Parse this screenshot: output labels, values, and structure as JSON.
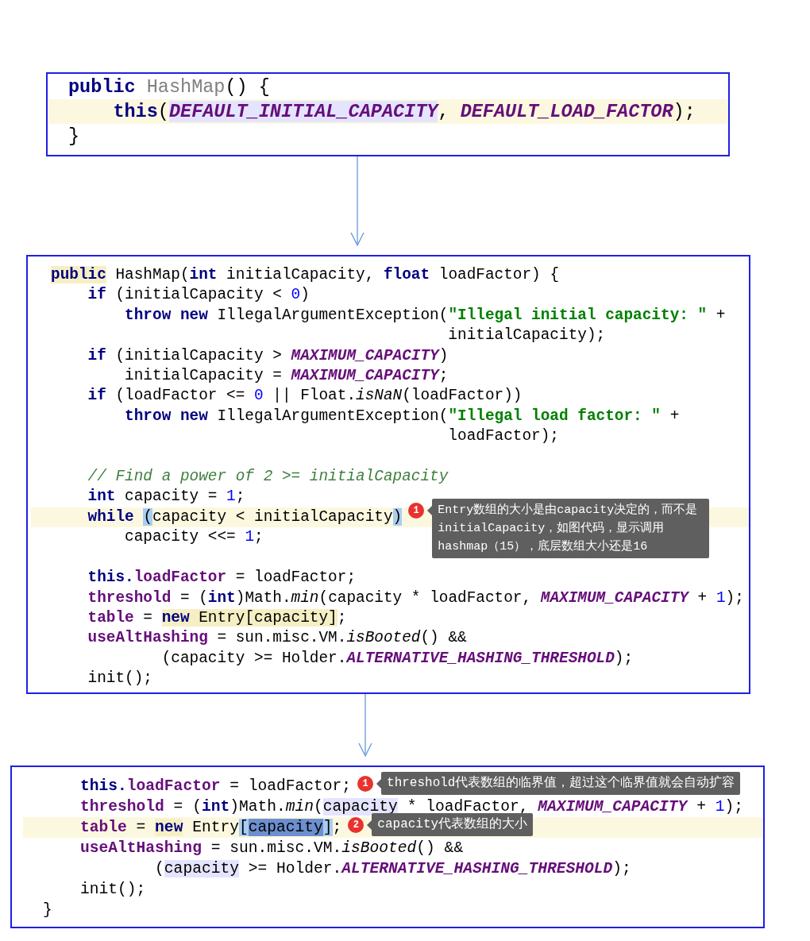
{
  "panels": [
    {
      "lines": [
        {
          "kind": "code",
          "highlighted": false,
          "tokens": [
            {
              "kind": "kw",
              "text": "public"
            },
            {
              "kind": "gray",
              "text": " HashMap"
            },
            {
              "kind": "plain",
              "text": "() {"
            }
          ]
        },
        {
          "kind": "code",
          "highlighted": true,
          "tokens": [
            {
              "kind": "kw",
              "text": "    this"
            },
            {
              "kind": "plain",
              "text": "("
            },
            {
              "kind": "const",
              "text": "DEFAULT_INITIAL_CAPACITY",
              "color": "#e4e4ff"
            },
            {
              "kind": "plain",
              "text": ", "
            },
            {
              "kind": "const",
              "text": "DEFAULT_LOAD_FACTOR"
            },
            {
              "kind": "plain",
              "text": ");"
            }
          ]
        },
        {
          "kind": "code",
          "highlighted": false,
          "tokens": [
            {
              "kind": "plain",
              "text": "}"
            }
          ]
        }
      ]
    },
    {
      "lines": [
        {
          "kind": "code",
          "highlighted": false,
          "tokens": [
            {
              "kind": "kw",
              "text": "public",
              "color": "#f6efc4"
            },
            {
              "kind": "plain",
              "text": " HashMap("
            },
            {
              "kind": "kw",
              "text": "int"
            },
            {
              "kind": "plain",
              "text": " initialCapacity, "
            },
            {
              "kind": "kw",
              "text": "float"
            },
            {
              "kind": "plain",
              "text": " loadFactor) {"
            }
          ]
        },
        {
          "kind": "code",
          "highlighted": false,
          "tokens": [
            {
              "kind": "kw",
              "text": "    if"
            },
            {
              "kind": "plain",
              "text": " (initialCapacity < "
            },
            {
              "kind": "num",
              "text": "0"
            },
            {
              "kind": "plain",
              "text": ")"
            }
          ]
        },
        {
          "kind": "code",
          "highlighted": false,
          "tokens": [
            {
              "kind": "kw",
              "text": "        throw new"
            },
            {
              "kind": "plain",
              "text": " IllegalArgumentException("
            },
            {
              "kind": "string",
              "text": "\"Illegal initial capacity: \""
            },
            {
              "kind": "plain",
              "text": " +"
            }
          ]
        },
        {
          "kind": "code",
          "highlighted": false,
          "tokens": [
            {
              "kind": "plain",
              "text": "                                           initialCapacity);"
            }
          ]
        },
        {
          "kind": "code",
          "highlighted": false,
          "tokens": [
            {
              "kind": "kw",
              "text": "    if"
            },
            {
              "kind": "plain",
              "text": " (initialCapacity > "
            },
            {
              "kind": "const",
              "text": "MAXIMUM_CAPACITY"
            },
            {
              "kind": "plain",
              "text": ")"
            }
          ]
        },
        {
          "kind": "code",
          "highlighted": false,
          "tokens": [
            {
              "kind": "plain",
              "text": "        initialCapacity = "
            },
            {
              "kind": "const",
              "text": "MAXIMUM_CAPACITY"
            },
            {
              "kind": "plain",
              "text": ";"
            }
          ]
        },
        {
          "kind": "code",
          "highlighted": false,
          "tokens": [
            {
              "kind": "kw",
              "text": "    if"
            },
            {
              "kind": "plain",
              "text": " (loadFactor <= "
            },
            {
              "kind": "num",
              "text": "0"
            },
            {
              "kind": "plain",
              "text": " || Float."
            },
            {
              "kind": "italic",
              "text": "isNaN"
            },
            {
              "kind": "plain",
              "text": "(loadFactor))"
            }
          ]
        },
        {
          "kind": "code",
          "highlighted": false,
          "tokens": [
            {
              "kind": "kw",
              "text": "        throw new"
            },
            {
              "kind": "plain",
              "text": " IllegalArgumentException("
            },
            {
              "kind": "string",
              "text": "\"Illegal load factor: \""
            },
            {
              "kind": "plain",
              "text": " +"
            }
          ]
        },
        {
          "kind": "code",
          "highlighted": false,
          "tokens": [
            {
              "kind": "plain",
              "text": "                                           loadFactor);"
            }
          ]
        },
        {
          "kind": "blank"
        },
        {
          "kind": "code",
          "highlighted": false,
          "tokens": [
            {
              "kind": "comment",
              "text": "    // Find a power of 2 >= initialCapacity"
            }
          ]
        },
        {
          "kind": "code",
          "highlighted": false,
          "tokens": [
            {
              "kind": "kw",
              "text": "    int"
            },
            {
              "kind": "plain",
              "text": " capacity = "
            },
            {
              "kind": "num",
              "text": "1"
            },
            {
              "kind": "plain",
              "text": ";"
            }
          ]
        },
        {
          "kind": "code",
          "highlighted": true,
          "tokens": [
            {
              "kind": "kw",
              "text": "    while "
            },
            {
              "kind": "plain",
              "text": "(",
              "color": "#a9cdf2"
            },
            {
              "kind": "plain",
              "text": "capacity < initialCapacity"
            },
            {
              "kind": "plain",
              "text": ")",
              "color": "#a9cdf2"
            }
          ],
          "note": {
            "number": "1",
            "text": "Entry数组的大小是由capacity决定的，而不是initialCapacity，如图代码，显示调用hashmap（15），底层数组大小还是16"
          }
        },
        {
          "kind": "code",
          "highlighted": false,
          "tokens": [
            {
              "kind": "plain",
              "text": "        capacity <<= "
            },
            {
              "kind": "num",
              "text": "1"
            },
            {
              "kind": "plain",
              "text": ";"
            }
          ]
        },
        {
          "kind": "blank"
        },
        {
          "kind": "code",
          "highlighted": false,
          "tokens": [
            {
              "kind": "kw",
              "text": "    this."
            },
            {
              "kind": "field",
              "text": "loadFactor"
            },
            {
              "kind": "plain",
              "text": " = loadFactor;"
            }
          ]
        },
        {
          "kind": "code",
          "highlighted": false,
          "tokens": [
            {
              "kind": "field",
              "text": "    threshold"
            },
            {
              "kind": "plain",
              "text": " = ("
            },
            {
              "kind": "kw",
              "text": "int"
            },
            {
              "kind": "plain",
              "text": ")Math."
            },
            {
              "kind": "italic",
              "text": "min"
            },
            {
              "kind": "plain",
              "text": "(capacity * loadFactor, "
            },
            {
              "kind": "const",
              "text": "MAXIMUM_CAPACITY"
            },
            {
              "kind": "plain",
              "text": " + "
            },
            {
              "kind": "num",
              "text": "1"
            },
            {
              "kind": "plain",
              "text": ");"
            }
          ]
        },
        {
          "kind": "code",
          "highlighted": false,
          "tokens": [
            {
              "kind": "field",
              "text": "    table"
            },
            {
              "kind": "plain",
              "text": " = "
            },
            {
              "kind": "kw",
              "text": "new",
              "color": "#f6efc4"
            },
            {
              "kind": "plain",
              "text": " Entry[capacity]",
              "color": "#f6efc4"
            },
            {
              "kind": "plain",
              "text": ";"
            }
          ]
        },
        {
          "kind": "code",
          "highlighted": false,
          "tokens": [
            {
              "kind": "field",
              "text": "    useAltHashing"
            },
            {
              "kind": "plain",
              "text": " = sun.misc.VM."
            },
            {
              "kind": "italic",
              "text": "isBooted"
            },
            {
              "kind": "plain",
              "text": "() &&"
            }
          ]
        },
        {
          "kind": "code",
          "highlighted": false,
          "tokens": [
            {
              "kind": "plain",
              "text": "            (capacity >= Holder."
            },
            {
              "kind": "const",
              "text": "ALTERNATIVE_HASHING_THRESHOLD"
            },
            {
              "kind": "plain",
              "text": ");"
            }
          ]
        },
        {
          "kind": "code",
          "highlighted": false,
          "tokens": [
            {
              "kind": "plain",
              "text": "    init();"
            }
          ]
        }
      ]
    },
    {
      "lines": [
        {
          "kind": "code",
          "highlighted": false,
          "tokens": [
            {
              "kind": "kw",
              "text": "    this."
            },
            {
              "kind": "field",
              "text": "loadFactor"
            },
            {
              "kind": "plain",
              "text": " = loadFactor;"
            }
          ],
          "note": {
            "number": "1",
            "text": "threshold代表数组的临界值，超过这个临界值就会自动扩容"
          }
        },
        {
          "kind": "code",
          "highlighted": false,
          "tokens": [
            {
              "kind": "field",
              "text": "    threshold"
            },
            {
              "kind": "plain",
              "text": " = ("
            },
            {
              "kind": "kw",
              "text": "int"
            },
            {
              "kind": "plain",
              "text": ")Math."
            },
            {
              "kind": "italic",
              "text": "min"
            },
            {
              "kind": "plain",
              "text": "("
            },
            {
              "kind": "plain",
              "text": "capacity",
              "color": "#e4e4ff"
            },
            {
              "kind": "plain",
              "text": " * loadFactor, "
            },
            {
              "kind": "const",
              "text": "MAXIMUM_CAPACITY"
            },
            {
              "kind": "plain",
              "text": " + "
            },
            {
              "kind": "num",
              "text": "1"
            },
            {
              "kind": "plain",
              "text": ");"
            }
          ]
        },
        {
          "kind": "code",
          "highlighted": true,
          "tokens": [
            {
              "kind": "field",
              "text": "    table"
            },
            {
              "kind": "plain",
              "text": " = "
            },
            {
              "kind": "kw",
              "text": "new",
              "color": "#f6efc4"
            },
            {
              "kind": "plain",
              "text": " Entry"
            },
            {
              "kind": "plain",
              "text": "[",
              "color": "#a9cdf2"
            },
            {
              "kind": "plain",
              "text": "capacity",
              "color": "#6d8fcf"
            },
            {
              "kind": "plain",
              "text": "]",
              "color": "#a9cdf2"
            },
            {
              "kind": "plain",
              "text": ";"
            }
          ],
          "note": {
            "number": "2",
            "text": "capacity代表数组的大小"
          }
        },
        {
          "kind": "code",
          "highlighted": false,
          "tokens": [
            {
              "kind": "field",
              "text": "    useAltHashing"
            },
            {
              "kind": "plain",
              "text": " = sun.misc.VM."
            },
            {
              "kind": "italic",
              "text": "isBooted"
            },
            {
              "kind": "plain",
              "text": "() &&"
            }
          ]
        },
        {
          "kind": "code",
          "highlighted": false,
          "tokens": [
            {
              "kind": "plain",
              "text": "            ("
            },
            {
              "kind": "plain",
              "text": "capacity",
              "color": "#e4e4ff"
            },
            {
              "kind": "plain",
              "text": " >= Holder."
            },
            {
              "kind": "const",
              "text": "ALTERNATIVE_HASHING_THRESHOLD"
            },
            {
              "kind": "plain",
              "text": ");"
            }
          ]
        },
        {
          "kind": "code",
          "highlighted": false,
          "tokens": [
            {
              "kind": "plain",
              "text": "    init();"
            }
          ]
        },
        {
          "kind": "code",
          "highlighted": false,
          "tokens": [
            {
              "kind": "plain",
              "text": "}"
            }
          ]
        }
      ]
    }
  ]
}
